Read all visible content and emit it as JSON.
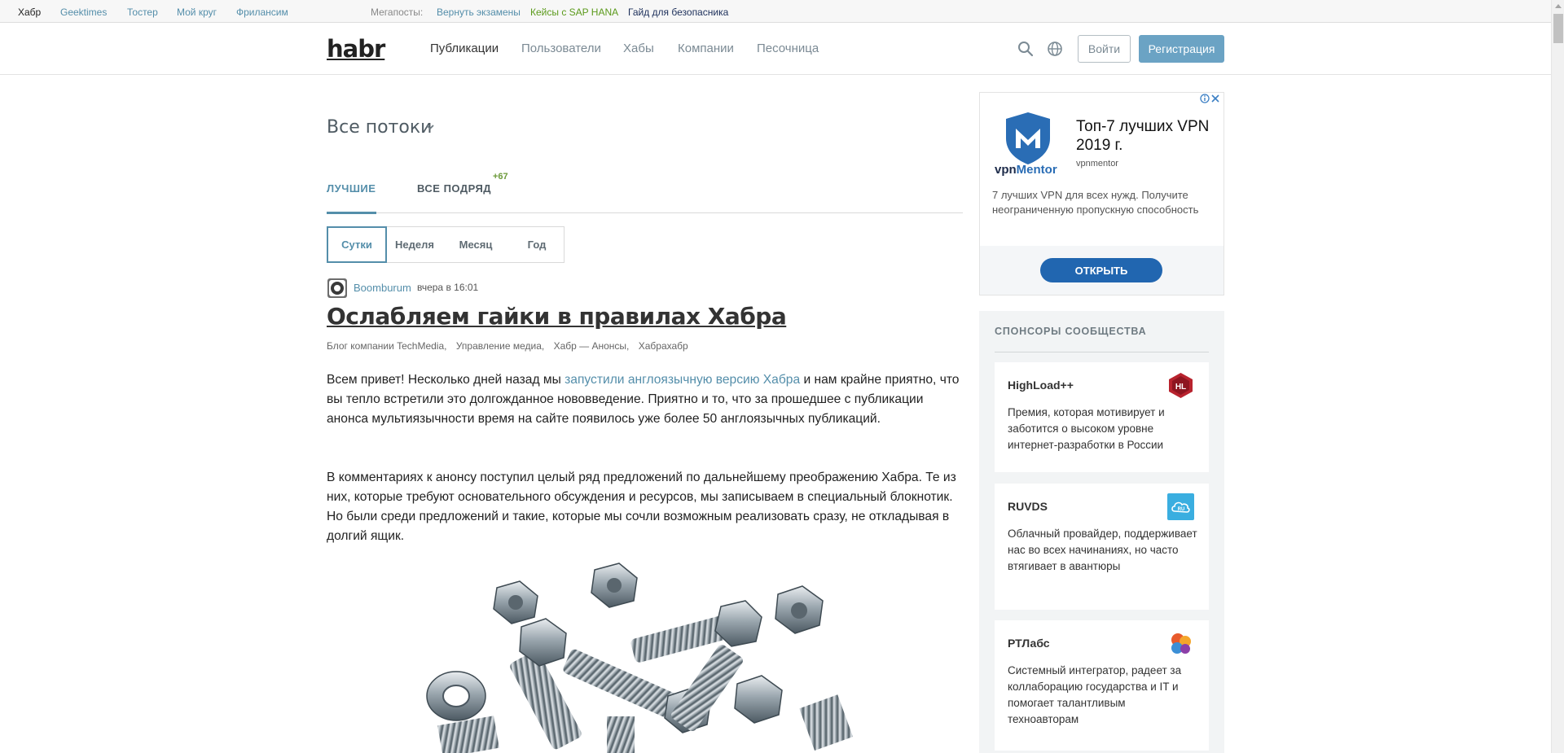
{
  "megabar": {
    "sites": [
      "Хабр",
      "Geektimes",
      "Тостер",
      "Мой круг",
      "Фрилансим"
    ],
    "label": "Мегапосты:",
    "posts": [
      "Вернуть экзамены",
      "Кейсы с SAP HANA",
      "Гайд для безопасника"
    ]
  },
  "header": {
    "logo": "habr",
    "nav": [
      "Публикации",
      "Пользователи",
      "Хабы",
      "Компании",
      "Песочница"
    ],
    "login_label": "Войти",
    "register_label": "Регистрация"
  },
  "feed": {
    "title": "Все потоки",
    "tabs": {
      "best": "ЛУЧШИЕ",
      "all": "ВСЕ ПОДРЯД",
      "all_count": "+67"
    },
    "periods": [
      "Сутки",
      "Неделя",
      "Месяц",
      "Год"
    ]
  },
  "post": {
    "author": "Boomburum",
    "time": "вчера в 16:01",
    "title": "Ослабляем гайки в правилах Хабра",
    "hubs": [
      "Блог компании TechMedia,",
      "Управление медиа,",
      "Хабр — Анонсы,",
      "Хабрахабр"
    ],
    "p1_before": "Всем привет! Несколько дней назад мы ",
    "p1_link": "запустили англоязычную версию Хабра",
    "p1_after": " и нам крайне приятно, что вы тепло встретили это долгожданное нововведение. Приятно и то, что за прошедшее с публикации анонса мультиязычности время на сайте появилось уже более 50 англоязычных публикаций.",
    "p2": "В комментариях к анонсу поступил целый ряд предложений по дальнейшему преображению Хабра. Те из них, которые требуют основательного обсуждения и ресурсов, мы записываем в специальный блокнотик. Но были среди предложений и такие, которые мы сочли возможным реализовать сразу, не откладывая в долгий ящик."
  },
  "ad": {
    "brand_a": "vpn",
    "brand_b": "Mentor",
    "headline": "Топ-7 лучших VPN 2019 г.",
    "source": "vpnmentor",
    "description": "7 лучших VPN для всех нужд. Получите неограниченную пропускную способность",
    "button": "ОТКРЫТЬ"
  },
  "sponsors": {
    "title": "СПОНСОРЫ СООБЩЕСТВА",
    "items": [
      {
        "name": "HighLoad++",
        "logo_text": "HL",
        "description": "Премия, которая мотивирует и заботится о высоком уровне интернет-разработки в России"
      },
      {
        "name": "RUVDS",
        "logo_text": "RU",
        "description": "Облачный провайдер, поддерживает нас во всех начинаниях, но часто втягивает в авантюры"
      },
      {
        "name": "РТЛабс",
        "logo_text": "",
        "description": "Системный интегратор, радеет за коллаборацию государства и IT и помогает талантливым техноавторам"
      }
    ]
  },
  "colors": {
    "accent": "#548eaa",
    "register_bg": "#6ba3c4",
    "ad_button": "#2166b0",
    "count_green": "#6c9a3a"
  }
}
